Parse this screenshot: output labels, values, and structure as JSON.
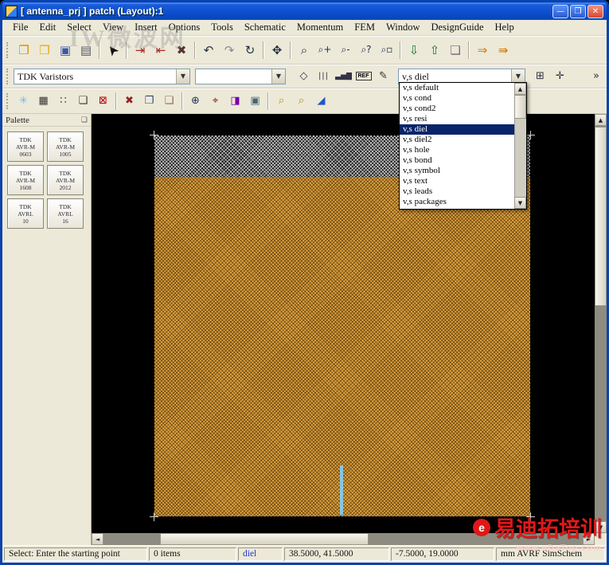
{
  "window": {
    "title": "[ antenna_prj ] patch (Layout):1",
    "minimize": "—",
    "maximize": "❐",
    "close": "✕"
  },
  "menu": {
    "items": [
      "File",
      "Edit",
      "Select",
      "View",
      "Insert",
      "Options",
      "Tools",
      "Schematic",
      "Momentum",
      "FEM",
      "Window",
      "DesignGuide",
      "Help"
    ]
  },
  "toolbar1": {
    "icons": [
      {
        "name": "new-design",
        "glyph": "❐"
      },
      {
        "name": "open-design",
        "glyph": "❒"
      },
      {
        "name": "save-design",
        "glyph": "▣"
      },
      {
        "name": "print-layout",
        "glyph": "▤"
      },
      {
        "name": "select-cursor",
        "glyph": "➤"
      },
      {
        "name": "insert-pin",
        "glyph": "⇥"
      },
      {
        "name": "insert-port",
        "glyph": "⇤"
      },
      {
        "name": "delete-items",
        "glyph": "✖"
      },
      {
        "name": "undo",
        "glyph": "↶"
      },
      {
        "name": "redo",
        "glyph": "↷"
      },
      {
        "name": "rotate-items",
        "glyph": "↻"
      },
      {
        "name": "move-items",
        "glyph": "✥"
      },
      {
        "name": "zoom-in-area",
        "glyph": "⌕"
      },
      {
        "name": "zoom-in",
        "glyph": "⌕+"
      },
      {
        "name": "zoom-out",
        "glyph": "⌕-"
      },
      {
        "name": "zoom-selection",
        "glyph": "⌕?"
      },
      {
        "name": "view-all",
        "glyph": "⌕▫"
      },
      {
        "name": "import-design",
        "glyph": "⇩"
      },
      {
        "name": "export-design",
        "glyph": "⇧"
      },
      {
        "name": "copy-hierarchy",
        "glyph": "❏"
      },
      {
        "name": "insert-trace",
        "glyph": "⇒"
      },
      {
        "name": "insert-path",
        "glyph": "⇛"
      }
    ]
  },
  "toolbar2": {
    "component_combo_value": "TDK Varistors",
    "secondary_combo_value": "",
    "layer_combo_value": "v,s diel",
    "icons_mid": [
      {
        "name": "draw-polygon",
        "glyph": "◇"
      },
      {
        "name": "layer-bars",
        "glyph": "|||"
      },
      {
        "name": "stack-chart",
        "glyph": "▃▅▇"
      },
      {
        "name": "ref-layer",
        "glyph": "REF"
      },
      {
        "name": "draw-pen",
        "glyph": "✎"
      }
    ],
    "icons_right": [
      {
        "name": "snap-grid",
        "glyph": "⊞"
      },
      {
        "name": "align-cross",
        "glyph": "✛"
      }
    ],
    "overflow": "»"
  },
  "toolbar3": {
    "icons": [
      {
        "name": "preferences",
        "glyph": "✳"
      },
      {
        "name": "grid-pattern",
        "glyph": "▦"
      },
      {
        "name": "grid-dots",
        "glyph": "∷"
      },
      {
        "name": "select-window",
        "glyph": "❑"
      },
      {
        "name": "clear-layer",
        "glyph": "⊠"
      },
      {
        "name": "delete-selected",
        "glyph": "✖"
      },
      {
        "name": "copy-items",
        "glyph": "❐"
      },
      {
        "name": "paste-items",
        "glyph": "❏"
      },
      {
        "name": "zoom-plus",
        "glyph": "⊕"
      },
      {
        "name": "origin-marker",
        "glyph": "⌖"
      },
      {
        "name": "copy-to-layer",
        "glyph": "◨"
      },
      {
        "name": "layer-editor",
        "glyph": "▣"
      },
      {
        "name": "find-component",
        "glyph": "⌕"
      },
      {
        "name": "preview",
        "glyph": "⌕"
      },
      {
        "name": "fill-gradient",
        "glyph": "◢"
      }
    ]
  },
  "layer_dropdown": {
    "items": [
      "v,s default",
      "v,s cond",
      "v,s cond2",
      "v,s resi",
      "v,s diel",
      "v,s diel2",
      "v,s hole",
      "v,s bond",
      "v,s symbol",
      "v,s text",
      "v,s leads",
      "v,s packages"
    ],
    "selected": "v,s diel"
  },
  "palette": {
    "title": "Palette",
    "items": [
      {
        "l1": "TDK",
        "l2": "AVR-M",
        "l3": "0603"
      },
      {
        "l1": "TDK",
        "l2": "AVR-M",
        "l3": "1005"
      },
      {
        "l1": "TDK",
        "l2": "AVR-M",
        "l3": "1608"
      },
      {
        "l1": "TDK",
        "l2": "AVR-M",
        "l3": "2012"
      },
      {
        "l1": "TDK",
        "l2": "AVRL",
        "l3": "10"
      },
      {
        "l1": "TDK",
        "l2": "AVRL",
        "l3": "16"
      }
    ]
  },
  "statusbar": {
    "message": "Select: Enter the starting point",
    "items_count": "0 items",
    "layer": "diel",
    "cursor_xy": "38.5000, 41.5000",
    "delta_xy": "-7.5000, 19.0000",
    "units_info": "mm  AVRF  SimSchem"
  },
  "watermarks": {
    "top_left": "IW微波网",
    "brand": "易迪拓培训",
    "brand_sub": "www.eDaTop.com",
    "logo_letter": "e"
  },
  "icons": {
    "combo_arrow": "▼",
    "scroll_up": "▲",
    "scroll_down": "▼",
    "scroll_left": "◄",
    "scroll_right": "►",
    "palette_dock": "❏"
  },
  "colors": {
    "titlebar_blue": "#0a55d8",
    "selection_navy": "#0a246a",
    "patch_orange": "#e2a43f",
    "substrate_gray": "#c8c8c8",
    "canvas_black": "#000000",
    "watermark_red": "#e01818",
    "layer_link_blue": "#2233cc"
  }
}
